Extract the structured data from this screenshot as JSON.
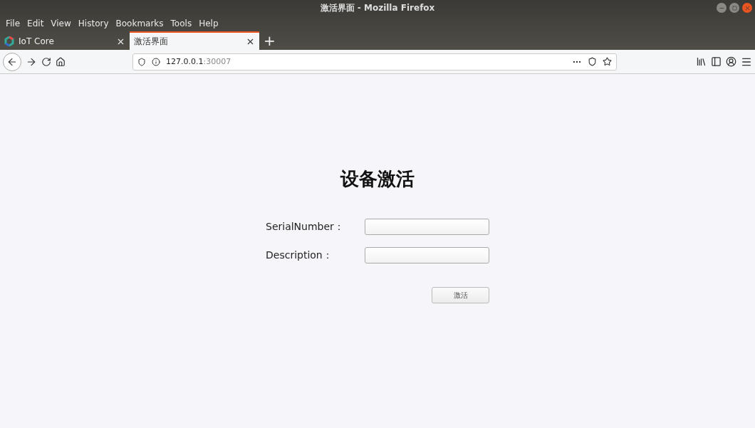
{
  "window": {
    "title": "激活界面 - Mozilla Firefox"
  },
  "menu": [
    "File",
    "Edit",
    "View",
    "History",
    "Bookmarks",
    "Tools",
    "Help"
  ],
  "tabs": [
    {
      "label": "IoT Core",
      "selected": false
    },
    {
      "label": "激活界面",
      "selected": true
    }
  ],
  "new_tab": "+",
  "address": {
    "host": "127.0.0.1",
    "port": ":30007"
  },
  "page": {
    "heading": "设备激活",
    "fields": [
      {
        "label": "SerialNumber："
      },
      {
        "label": "Description："
      }
    ],
    "button": "激活"
  }
}
